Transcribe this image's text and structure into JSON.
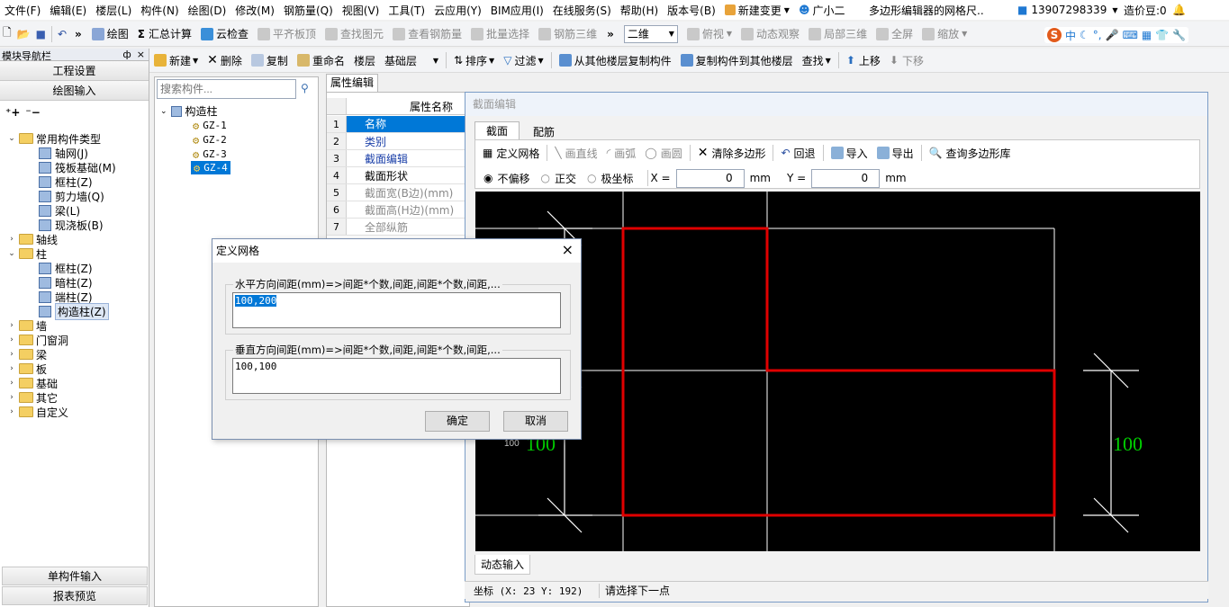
{
  "menu": {
    "items": [
      "文件(F)",
      "编辑(E)",
      "楼层(L)",
      "构件(N)",
      "绘图(D)",
      "修改(M)",
      "钢筋量(Q)",
      "视图(V)",
      "工具(T)",
      "云应用(Y)",
      "BIM应用(I)",
      "在线服务(S)",
      "帮助(H)",
      "版本号(B)"
    ],
    "new_change": "新建变更",
    "assistant": "广小二",
    "doc_title": "多边形编辑器的网格尺..",
    "phone": "13907298339",
    "price_bean": "造价豆:0"
  },
  "toolbar1": {
    "items": [
      "绘图",
      "汇总计算",
      "云检查",
      "平齐板顶",
      "查找图元",
      "查看钢筋量",
      "批量选择",
      "钢筋三维"
    ],
    "view_select": "二维",
    "view_items": [
      "俯视",
      "动态观察",
      "局部三维",
      "全屏",
      "缩放"
    ],
    "ime": "中"
  },
  "toolbar2": {
    "items": [
      "新建",
      "删除",
      "复制",
      "重命名"
    ],
    "floor_label": "楼层",
    "floor_value": "基础层",
    "items2": [
      "排序",
      "过滤",
      "从其他楼层复制构件",
      "复制构件到其他楼层",
      "查找",
      "上移",
      "下移"
    ]
  },
  "nav": {
    "title": "模块导航栏",
    "pin": "ф",
    "close": "×",
    "btn_project": "工程设置",
    "btn_draw": "绘图输入",
    "tree": [
      {
        "label": "常用构件类型",
        "level": 0,
        "type": "folder",
        "expanded": true
      },
      {
        "label": "轴网(J)",
        "level": 1,
        "type": "comp"
      },
      {
        "label": "筏板基础(M)",
        "level": 1,
        "type": "comp"
      },
      {
        "label": "框柱(Z)",
        "level": 1,
        "type": "comp"
      },
      {
        "label": "剪力墙(Q)",
        "level": 1,
        "type": "comp"
      },
      {
        "label": "梁(L)",
        "level": 1,
        "type": "comp"
      },
      {
        "label": "现浇板(B)",
        "level": 1,
        "type": "comp"
      },
      {
        "label": "轴线",
        "level": 0,
        "type": "folder",
        "expanded": false
      },
      {
        "label": "柱",
        "level": 0,
        "type": "folder",
        "expanded": true
      },
      {
        "label": "框柱(Z)",
        "level": 1,
        "type": "comp"
      },
      {
        "label": "暗柱(Z)",
        "level": 1,
        "type": "comp"
      },
      {
        "label": "端柱(Z)",
        "level": 1,
        "type": "comp"
      },
      {
        "label": "构造柱(Z)",
        "level": 1,
        "type": "comp",
        "selected": true
      },
      {
        "label": "墙",
        "level": 0,
        "type": "folder"
      },
      {
        "label": "门窗洞",
        "level": 0,
        "type": "folder"
      },
      {
        "label": "梁",
        "level": 0,
        "type": "folder"
      },
      {
        "label": "板",
        "level": 0,
        "type": "folder"
      },
      {
        "label": "基础",
        "level": 0,
        "type": "folder"
      },
      {
        "label": "其它",
        "level": 0,
        "type": "folder"
      },
      {
        "label": "自定义",
        "level": 0,
        "type": "folder"
      }
    ],
    "btn_single": "单构件输入",
    "btn_report": "报表预览"
  },
  "components": {
    "search_placeholder": "搜索构件...",
    "root": "构造柱",
    "items": [
      "GZ-1",
      "GZ-2",
      "GZ-3",
      "GZ-4"
    ],
    "selected": "GZ-4"
  },
  "properties": {
    "tab": "属性编辑",
    "header": "属性名称",
    "rows": [
      {
        "num": "1",
        "name": "名称"
      },
      {
        "num": "2",
        "name": "类别"
      },
      {
        "num": "3",
        "name": "截面编辑"
      },
      {
        "num": "4",
        "name": "截面形状"
      },
      {
        "num": "5",
        "name": "截面宽(B边)(mm)"
      },
      {
        "num": "6",
        "name": "截面高(H边)(mm)"
      },
      {
        "num": "7",
        "name": "全部纵筋"
      }
    ]
  },
  "section_editor": {
    "title": "截面编辑",
    "tab_section": "截面",
    "tab_rebar": "配筋",
    "tools": [
      "定义网格",
      "画直线",
      "画弧",
      "画圆",
      "清除多边形",
      "回退",
      "导入",
      "导出",
      "查询多边形库"
    ],
    "radio_no_offset": "不偏移",
    "radio_ortho": "正交",
    "radio_polar": "极坐标",
    "x_label": "X =",
    "x_value": "0",
    "y_label": "Y =",
    "y_value": "0",
    "unit": "mm",
    "dim_right": "100",
    "dim_left": "100",
    "dim_left_small": "100",
    "dynamic_input": "动态输入",
    "status_coord": "坐标 (X: 23 Y: 192)",
    "status_msg": "请选择下一点"
  },
  "dialog": {
    "title": "定义网格",
    "close": "×",
    "h_label": "水平方向间距(mm)=>间距*个数,间距,间距*个数,间距,...",
    "h_value": "100,200",
    "v_label": "垂直方向间距(mm)=>间距*个数,间距,间距*个数,间距,...",
    "v_value": "100,100",
    "ok": "确定",
    "cancel": "取消"
  },
  "colors": {
    "selection_blue": "#0078d7",
    "polygon_red": "#e00000",
    "dim_green": "#00d000",
    "canvas_black": "#000000"
  }
}
